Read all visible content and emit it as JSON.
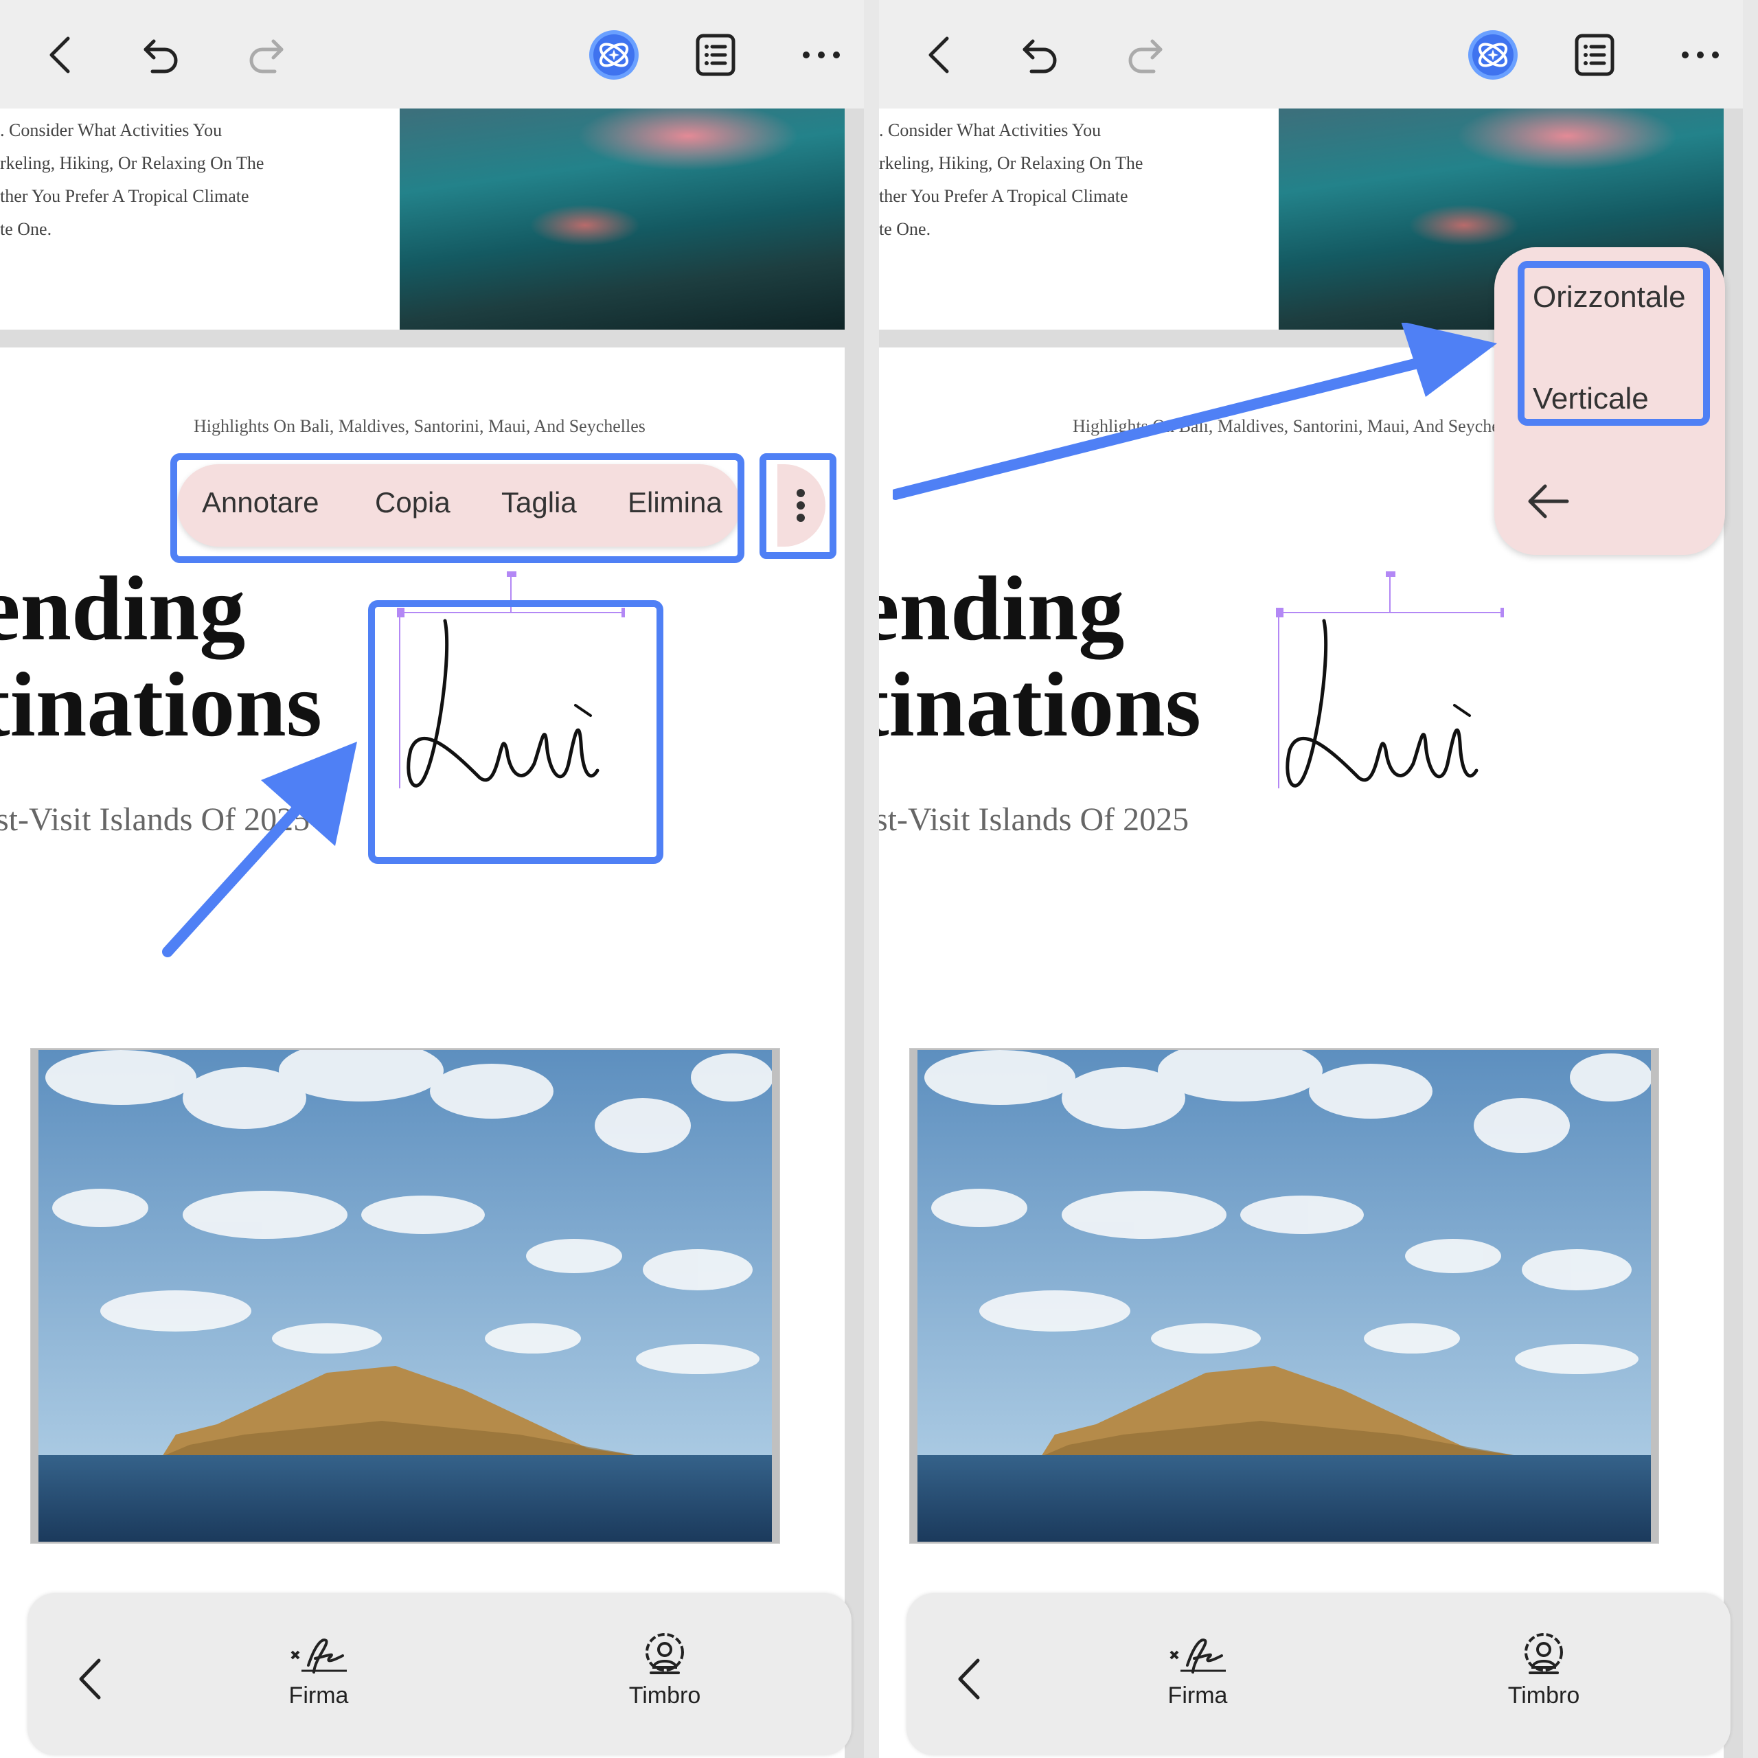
{
  "toolbar": {
    "icons": [
      "back-icon",
      "undo-icon",
      "redo-icon",
      "ai-assistant-icon",
      "outline-icon",
      "more-icon"
    ]
  },
  "document": {
    "intro_lines": [
      ". Consider What Activities You",
      "rkeling, Hiking, Or Relaxing On The",
      "ther You Prefer A Tropical Climate",
      "te One."
    ],
    "highlights": "Highlights On Bali, Maldives, Santorini, Maui, And  Seychelles",
    "title_line1": "ending",
    "title_line2": "tinations",
    "subtitle": "st-Visit Islands Of 2025"
  },
  "context_menu": {
    "items": [
      "Annotare",
      "Copia",
      "Taglia",
      "Elimina"
    ],
    "more_icon": "vertical-dots-icon"
  },
  "orientation_popup": {
    "options": [
      "Orizzontale",
      "Verticale"
    ],
    "back_icon": "arrow-left-icon"
  },
  "bottom_bar": {
    "signature_label": "Firma",
    "stamp_label": "Timbro"
  },
  "colors": {
    "highlight": "#4f80f5",
    "menu_bg": "#f5dede",
    "selection": "#b388f5"
  }
}
